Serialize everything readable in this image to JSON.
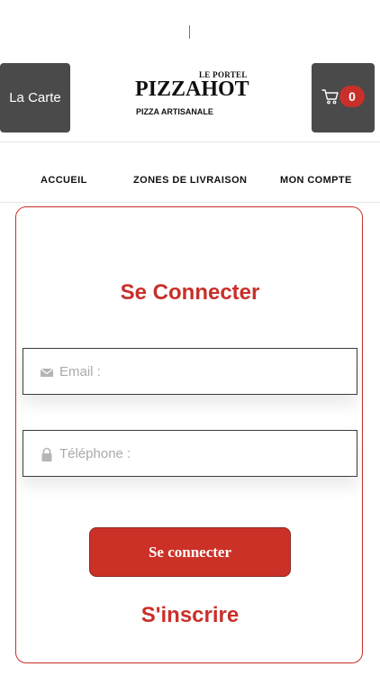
{
  "header": {
    "menu_button_label": "La Carte",
    "logo": {
      "tagline_top": "LE PORTEL",
      "brand": "PIZZAHOT",
      "tagline_bottom": "PIZZA ARTISANALE"
    },
    "cart": {
      "icon": "cart-icon",
      "count": "0"
    }
  },
  "nav": {
    "items": [
      {
        "label": "ACCUEIL"
      },
      {
        "label": "ZONES DE LIVRAISON"
      },
      {
        "label": "MON COMPTE"
      }
    ]
  },
  "login": {
    "title": "Se Connecter",
    "email": {
      "icon": "envelope-icon",
      "placeholder": "Email :",
      "value": ""
    },
    "phone": {
      "icon": "lock-icon",
      "placeholder": "Téléphone :",
      "value": ""
    },
    "submit_label": "Se connecter",
    "register_label": "S'inscrire"
  },
  "colors": {
    "accent": "#c8302a",
    "header_button": "#4a4a4a"
  }
}
